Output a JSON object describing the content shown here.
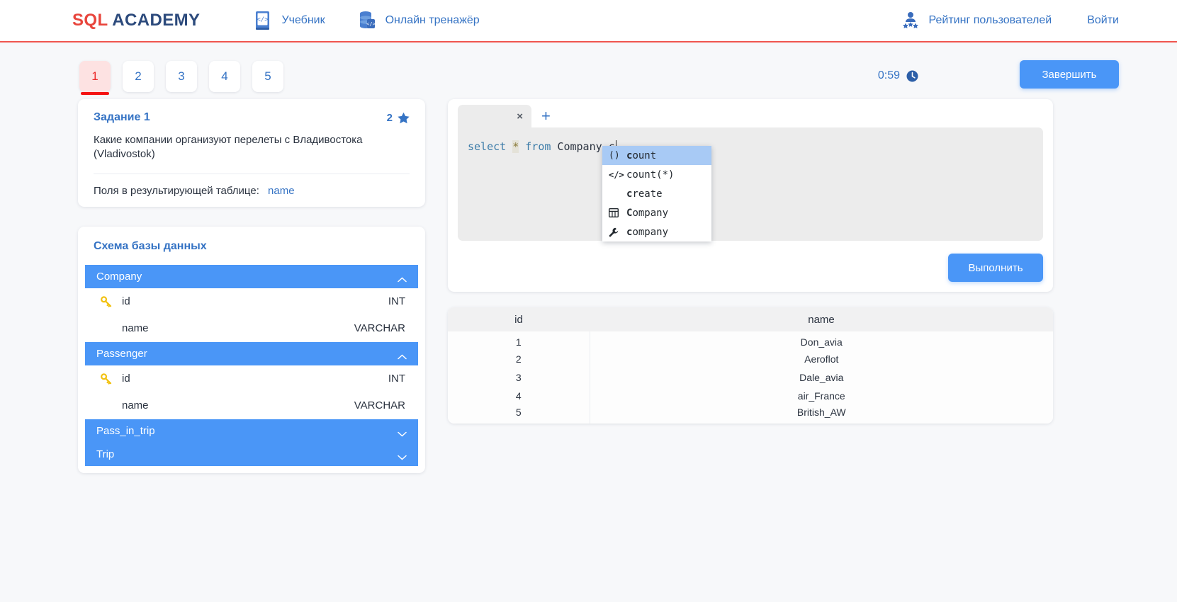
{
  "header": {
    "logo_sql": "SQL",
    "logo_academy": "ACADEMY",
    "nav": [
      {
        "label": "Учебник",
        "icon": "book-code-icon"
      },
      {
        "label": "Онлайн тренажёр",
        "icon": "database-code-icon"
      }
    ],
    "rating_label": "Рейтинг пользователей",
    "rating_icon": "users-rating-icon",
    "login_label": "Войти"
  },
  "pager": {
    "items": [
      "1",
      "2",
      "3",
      "4",
      "5"
    ],
    "active_index": 0
  },
  "timer": {
    "value": "0:59",
    "icon": "clock-icon"
  },
  "finish_button": {
    "label": "Завершить"
  },
  "task": {
    "title": "Задание 1",
    "stars_count": "2",
    "star_icon": "star-icon",
    "question": "Какие компании организуют перелеты с Владивостока (Vladivostok)",
    "fields_label": "Поля в результирующей таблице:",
    "fields_value": "name"
  },
  "schema": {
    "title": "Схема базы данных",
    "tables": [
      {
        "name": "Company",
        "expanded": true,
        "chevron": "chevron-up-icon",
        "columns": [
          {
            "name": "id",
            "type": "INT",
            "primary_key": true,
            "key_icon": "key-icon"
          },
          {
            "name": "name",
            "type": "VARCHAR",
            "primary_key": false
          }
        ]
      },
      {
        "name": "Passenger",
        "expanded": true,
        "chevron": "chevron-up-icon",
        "columns": [
          {
            "name": "id",
            "type": "INT",
            "primary_key": true,
            "key_icon": "key-icon"
          },
          {
            "name": "name",
            "type": "VARCHAR",
            "primary_key": false
          }
        ]
      },
      {
        "name": "Pass_in_trip",
        "expanded": false,
        "chevron": "chevron-down-icon",
        "columns": []
      },
      {
        "name": "Trip",
        "expanded": false,
        "chevron": "chevron-down-icon",
        "columns": []
      }
    ]
  },
  "editor": {
    "tab_close_label": "×",
    "tab_add_label": "+",
    "code": {
      "full_text": "select * from Company c",
      "tokens": [
        {
          "text": "select",
          "type": "keyword"
        },
        {
          "text": " ",
          "type": "plain"
        },
        {
          "text": "*",
          "type": "operator"
        },
        {
          "text": " ",
          "type": "plain"
        },
        {
          "text": "from",
          "type": "keyword"
        },
        {
          "text": " Company c",
          "type": "plain"
        }
      ]
    },
    "autocomplete": {
      "selected_index": 0,
      "items": [
        {
          "label": "count",
          "prefix": "c",
          "rest": "ount",
          "icon": "parentheses-icon",
          "icon_text": "()"
        },
        {
          "label": "count(*)",
          "prefix": "",
          "rest": "count(*)",
          "icon": "code-tag-icon",
          "icon_text": "</>"
        },
        {
          "label": "create",
          "prefix": "c",
          "rest": "reate",
          "icon": "none",
          "icon_text": ""
        },
        {
          "label": "Company",
          "prefix": "C",
          "rest": "ompany",
          "icon": "table-icon",
          "icon_text": ""
        },
        {
          "label": "company",
          "prefix": "c",
          "rest": "ompany",
          "icon": "wrench-icon",
          "icon_text": ""
        }
      ]
    },
    "run_button": {
      "label": "Выполнить"
    }
  },
  "result": {
    "columns": [
      "id",
      "name"
    ],
    "rows": [
      {
        "id": "1",
        "name": "Don_avia"
      },
      {
        "id": "2",
        "name": "Aeroflot"
      },
      {
        "id": "3",
        "name": "Dale_avia"
      },
      {
        "id": "4",
        "name": "air_France"
      },
      {
        "id": "5",
        "name": "British_AW"
      }
    ]
  },
  "colors": {
    "brand_red": "#e8453c",
    "brand_navy": "#2c4a7c",
    "accent_blue": "#4a96f7",
    "link_blue": "#3573c4",
    "active_pager_bg": "#fde2e2",
    "active_pager_text": "#ec2b2b",
    "page_bg": "#f7f8fa"
  }
}
